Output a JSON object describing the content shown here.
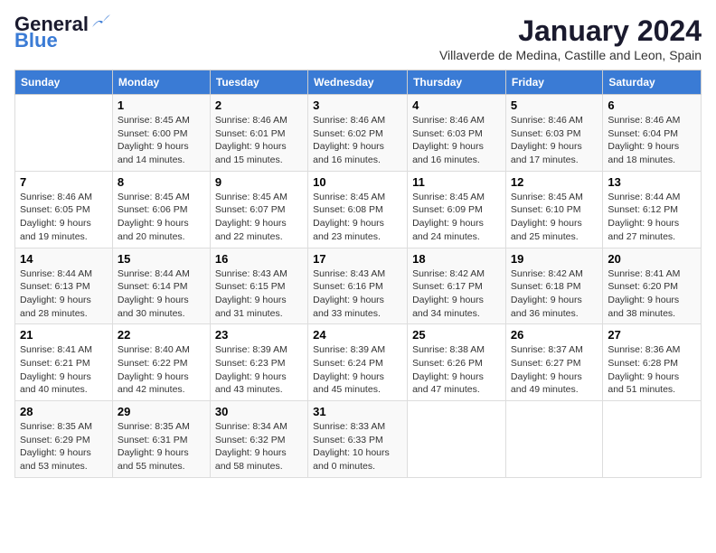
{
  "app": {
    "logo_general": "General",
    "logo_blue": "Blue",
    "month": "January 2024",
    "location": "Villaverde de Medina, Castille and Leon, Spain"
  },
  "calendar": {
    "days_of_week": [
      "Sunday",
      "Monday",
      "Tuesday",
      "Wednesday",
      "Thursday",
      "Friday",
      "Saturday"
    ],
    "weeks": [
      [
        {
          "day": "",
          "info": ""
        },
        {
          "day": "1",
          "info": "Sunrise: 8:45 AM\nSunset: 6:00 PM\nDaylight: 9 hours\nand 14 minutes."
        },
        {
          "day": "2",
          "info": "Sunrise: 8:46 AM\nSunset: 6:01 PM\nDaylight: 9 hours\nand 15 minutes."
        },
        {
          "day": "3",
          "info": "Sunrise: 8:46 AM\nSunset: 6:02 PM\nDaylight: 9 hours\nand 16 minutes."
        },
        {
          "day": "4",
          "info": "Sunrise: 8:46 AM\nSunset: 6:03 PM\nDaylight: 9 hours\nand 16 minutes."
        },
        {
          "day": "5",
          "info": "Sunrise: 8:46 AM\nSunset: 6:03 PM\nDaylight: 9 hours\nand 17 minutes."
        },
        {
          "day": "6",
          "info": "Sunrise: 8:46 AM\nSunset: 6:04 PM\nDaylight: 9 hours\nand 18 minutes."
        }
      ],
      [
        {
          "day": "7",
          "info": "Sunrise: 8:46 AM\nSunset: 6:05 PM\nDaylight: 9 hours\nand 19 minutes."
        },
        {
          "day": "8",
          "info": "Sunrise: 8:45 AM\nSunset: 6:06 PM\nDaylight: 9 hours\nand 20 minutes."
        },
        {
          "day": "9",
          "info": "Sunrise: 8:45 AM\nSunset: 6:07 PM\nDaylight: 9 hours\nand 22 minutes."
        },
        {
          "day": "10",
          "info": "Sunrise: 8:45 AM\nSunset: 6:08 PM\nDaylight: 9 hours\nand 23 minutes."
        },
        {
          "day": "11",
          "info": "Sunrise: 8:45 AM\nSunset: 6:09 PM\nDaylight: 9 hours\nand 24 minutes."
        },
        {
          "day": "12",
          "info": "Sunrise: 8:45 AM\nSunset: 6:10 PM\nDaylight: 9 hours\nand 25 minutes."
        },
        {
          "day": "13",
          "info": "Sunrise: 8:44 AM\nSunset: 6:12 PM\nDaylight: 9 hours\nand 27 minutes."
        }
      ],
      [
        {
          "day": "14",
          "info": "Sunrise: 8:44 AM\nSunset: 6:13 PM\nDaylight: 9 hours\nand 28 minutes."
        },
        {
          "day": "15",
          "info": "Sunrise: 8:44 AM\nSunset: 6:14 PM\nDaylight: 9 hours\nand 30 minutes."
        },
        {
          "day": "16",
          "info": "Sunrise: 8:43 AM\nSunset: 6:15 PM\nDaylight: 9 hours\nand 31 minutes."
        },
        {
          "day": "17",
          "info": "Sunrise: 8:43 AM\nSunset: 6:16 PM\nDaylight: 9 hours\nand 33 minutes."
        },
        {
          "day": "18",
          "info": "Sunrise: 8:42 AM\nSunset: 6:17 PM\nDaylight: 9 hours\nand 34 minutes."
        },
        {
          "day": "19",
          "info": "Sunrise: 8:42 AM\nSunset: 6:18 PM\nDaylight: 9 hours\nand 36 minutes."
        },
        {
          "day": "20",
          "info": "Sunrise: 8:41 AM\nSunset: 6:20 PM\nDaylight: 9 hours\nand 38 minutes."
        }
      ],
      [
        {
          "day": "21",
          "info": "Sunrise: 8:41 AM\nSunset: 6:21 PM\nDaylight: 9 hours\nand 40 minutes."
        },
        {
          "day": "22",
          "info": "Sunrise: 8:40 AM\nSunset: 6:22 PM\nDaylight: 9 hours\nand 42 minutes."
        },
        {
          "day": "23",
          "info": "Sunrise: 8:39 AM\nSunset: 6:23 PM\nDaylight: 9 hours\nand 43 minutes."
        },
        {
          "day": "24",
          "info": "Sunrise: 8:39 AM\nSunset: 6:24 PM\nDaylight: 9 hours\nand 45 minutes."
        },
        {
          "day": "25",
          "info": "Sunrise: 8:38 AM\nSunset: 6:26 PM\nDaylight: 9 hours\nand 47 minutes."
        },
        {
          "day": "26",
          "info": "Sunrise: 8:37 AM\nSunset: 6:27 PM\nDaylight: 9 hours\nand 49 minutes."
        },
        {
          "day": "27",
          "info": "Sunrise: 8:36 AM\nSunset: 6:28 PM\nDaylight: 9 hours\nand 51 minutes."
        }
      ],
      [
        {
          "day": "28",
          "info": "Sunrise: 8:35 AM\nSunset: 6:29 PM\nDaylight: 9 hours\nand 53 minutes."
        },
        {
          "day": "29",
          "info": "Sunrise: 8:35 AM\nSunset: 6:31 PM\nDaylight: 9 hours\nand 55 minutes."
        },
        {
          "day": "30",
          "info": "Sunrise: 8:34 AM\nSunset: 6:32 PM\nDaylight: 9 hours\nand 58 minutes."
        },
        {
          "day": "31",
          "info": "Sunrise: 8:33 AM\nSunset: 6:33 PM\nDaylight: 10 hours\nand 0 minutes."
        },
        {
          "day": "",
          "info": ""
        },
        {
          "day": "",
          "info": ""
        },
        {
          "day": "",
          "info": ""
        }
      ]
    ]
  }
}
